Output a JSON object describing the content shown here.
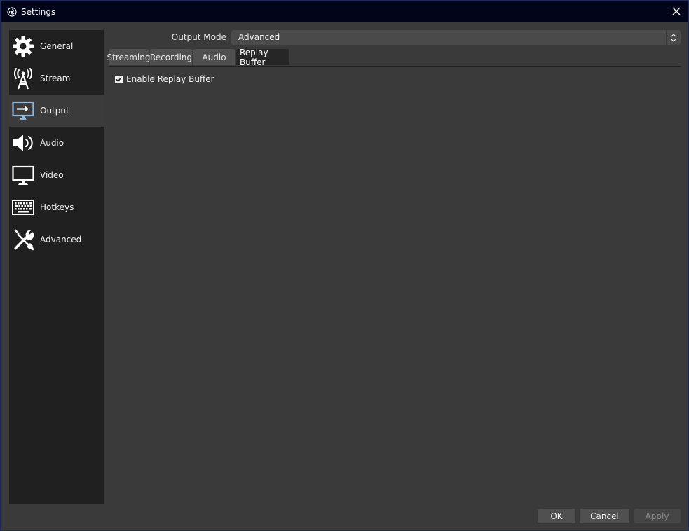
{
  "window": {
    "title": "Settings"
  },
  "sidebar": {
    "items": [
      {
        "label": "General",
        "icon": "gear-icon"
      },
      {
        "label": "Stream",
        "icon": "antenna-icon"
      },
      {
        "label": "Output",
        "icon": "output-monitor-icon",
        "selected": true
      },
      {
        "label": "Audio",
        "icon": "speaker-icon"
      },
      {
        "label": "Video",
        "icon": "monitor-icon"
      },
      {
        "label": "Hotkeys",
        "icon": "keyboard-icon"
      },
      {
        "label": "Advanced",
        "icon": "wrench-screwdriver-icon"
      }
    ]
  },
  "output": {
    "mode_label": "Output Mode",
    "mode_value": "Advanced",
    "tabs": [
      {
        "label": "Streaming"
      },
      {
        "label": "Recording"
      },
      {
        "label": "Audio"
      },
      {
        "label": "Replay Buffer",
        "active": true
      }
    ],
    "replay_buffer": {
      "enable_label": "Enable Replay Buffer",
      "enabled": true
    }
  },
  "buttons": {
    "ok": "OK",
    "cancel": "Cancel",
    "apply": "Apply"
  },
  "colors": {
    "window_bg": "#3a3a3a",
    "sidebar_bg": "#202020",
    "selected_item_bg": "#3b3b3b",
    "titlebar_bg": "#01051a",
    "output_icon_accent": "#8fb8e0"
  }
}
